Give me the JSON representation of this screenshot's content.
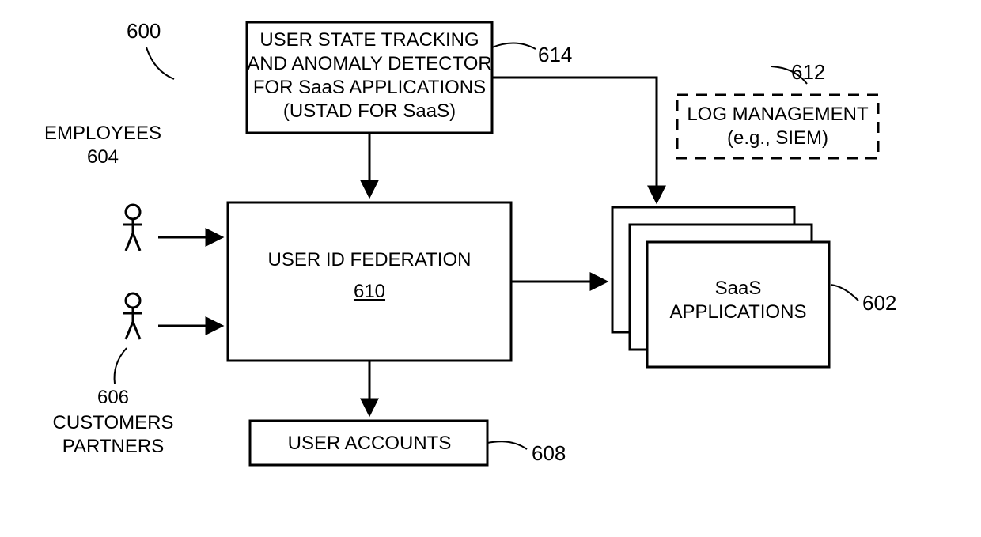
{
  "figure_number": "600",
  "employees": {
    "label": "EMPLOYEES",
    "ref": "604"
  },
  "customers_partners": {
    "label1": "CUSTOMERS",
    "label2": "PARTNERS",
    "ref": "606"
  },
  "ustad_box": {
    "line1": "USER STATE TRACKING",
    "line2": "AND ANOMALY DETECTOR",
    "line3": "FOR SaaS APPLICATIONS",
    "line4": "(USTAD FOR SaaS)",
    "ref": "614"
  },
  "federation_box": {
    "title": "USER ID FEDERATION",
    "ref": "610"
  },
  "accounts_box": {
    "title": "USER ACCOUNTS",
    "ref": "608"
  },
  "log_box": {
    "line1": "LOG MANAGEMENT",
    "line2": "(e.g., SIEM)",
    "ref": "612"
  },
  "saas_box": {
    "line1": "SaaS",
    "line2": "APPLICATIONS",
    "ref": "602"
  }
}
